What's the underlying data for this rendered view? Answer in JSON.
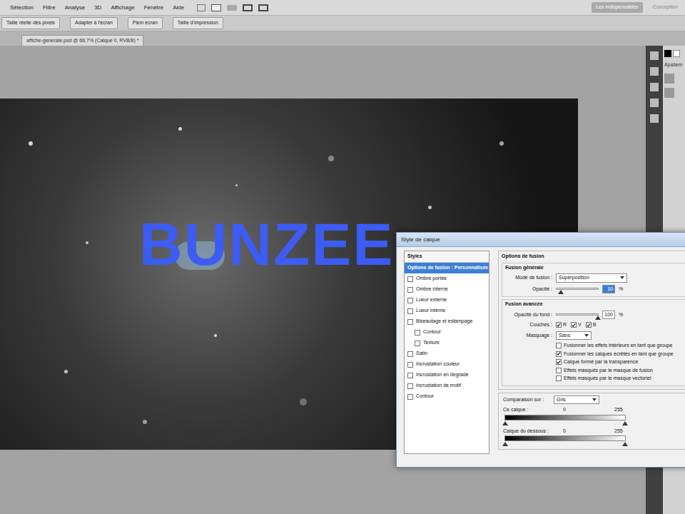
{
  "menu_bar": {
    "items": [
      "Sélection",
      "Filtre",
      "Analyse",
      "3D",
      "Affichage",
      "Fenêtre",
      "Aide"
    ],
    "workspaces": [
      {
        "label": "Les indispensables",
        "selected": true
      },
      {
        "label": "Conception",
        "selected": false
      }
    ]
  },
  "options_bar": {
    "buttons": [
      "Taille réelle des pixels",
      "Adapter à l'écran",
      "Plein écran",
      "Taille d'impression"
    ]
  },
  "document_tab": {
    "title": "affiche-generale.psd @ 66,7% (Calque 0, RVB/8) *"
  },
  "canvas": {
    "text": "BUNZEE"
  },
  "right_panel": {
    "tab": "Ajustem"
  },
  "dialog": {
    "title": "Style de calque",
    "styles_header": "Styles",
    "styles": [
      {
        "label": "Options de fusion : Personnalisée",
        "kind": "option",
        "checked": false,
        "selected": true
      },
      {
        "label": "Ombre portée",
        "kind": "effect",
        "checked": false,
        "selected": false
      },
      {
        "label": "Ombre interne",
        "kind": "effect",
        "checked": false,
        "selected": false
      },
      {
        "label": "Lueur externe",
        "kind": "effect",
        "checked": false,
        "selected": false
      },
      {
        "label": "Lueur interne",
        "kind": "effect",
        "checked": false,
        "selected": false
      },
      {
        "label": "Biseautage et estampage",
        "kind": "effect",
        "checked": false,
        "selected": false
      },
      {
        "label": "Contour",
        "kind": "sub",
        "checked": false,
        "selected": false
      },
      {
        "label": "Texture",
        "kind": "sub",
        "checked": false,
        "selected": false
      },
      {
        "label": "Satin",
        "kind": "effect",
        "checked": false,
        "selected": false
      },
      {
        "label": "Incrustation couleur",
        "kind": "effect",
        "checked": false,
        "selected": false
      },
      {
        "label": "Incrustation en dégradé",
        "kind": "effect",
        "checked": false,
        "selected": false
      },
      {
        "label": "Incrustation de motif",
        "kind": "effect",
        "checked": false,
        "selected": false
      },
      {
        "label": "Contour",
        "kind": "effect",
        "checked": false,
        "selected": false
      }
    ],
    "blending": {
      "group_title": "Options de fusion",
      "general_title": "Fusion générale",
      "mode_label": "Mode de fusion :",
      "mode_value": "Superposition",
      "opacity_label": "Opacité :",
      "opacity": {
        "value": "10",
        "unit": "%",
        "level": 0.1
      },
      "advanced_title": "Fusion avancée",
      "fill_label": "Opacité du fond :",
      "fill": {
        "value": "100",
        "unit": "%",
        "level": 1
      },
      "channels_label": "Couches :",
      "channels": [
        {
          "label": "R",
          "checked": true
        },
        {
          "label": "V",
          "checked": true
        },
        {
          "label": "B",
          "checked": true
        }
      ],
      "knockout_label": "Masquage :",
      "knockout_value": "Sans",
      "options": [
        {
          "label": "Fusionner les effets intérieurs en tant que groupe",
          "checked": false
        },
        {
          "label": "Fusionner les calques écrêtés en tant que groupe",
          "checked": true
        },
        {
          "label": "Calque formé par la transparence",
          "checked": true
        },
        {
          "label": "Effets masqués par le masque de fusion",
          "checked": false
        },
        {
          "label": "Effets masqués par le masque vectoriel",
          "checked": false
        }
      ]
    },
    "blend_if": {
      "label": "Comparaison sur :",
      "value": "Gris",
      "bars": [
        {
          "label": "Ce calque :",
          "low": {
            "value": "0",
            "level": 0
          },
          "high": {
            "value": "255",
            "level": 1
          }
        },
        {
          "label": "Calque du dessous :",
          "low": {
            "value": "0",
            "level": 0
          },
          "high": {
            "value": "255",
            "level": 1
          }
        }
      ]
    }
  }
}
